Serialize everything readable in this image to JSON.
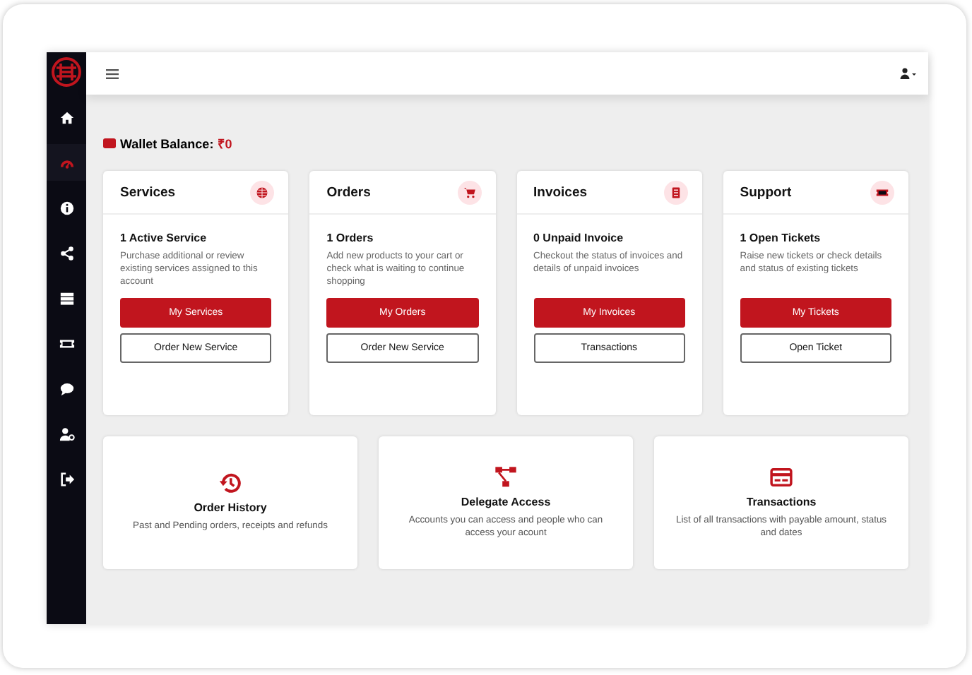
{
  "sidebar": {
    "items": [
      {
        "kind": "home",
        "selected": false
      },
      {
        "kind": "dashboard",
        "selected": true
      },
      {
        "kind": "info",
        "selected": false
      },
      {
        "kind": "share",
        "selected": false
      },
      {
        "kind": "server",
        "selected": false
      },
      {
        "kind": "ticket",
        "selected": false
      },
      {
        "kind": "comment",
        "selected": false
      },
      {
        "kind": "user-settings",
        "selected": false
      },
      {
        "kind": "logout",
        "selected": false
      }
    ]
  },
  "wallet": {
    "label": "Wallet Balance:",
    "amount": "₹0"
  },
  "cards": [
    {
      "title": "Services",
      "kind": "globe",
      "count": "1 Active Service",
      "description": "Purchase additional or review existing services assigned to this account",
      "buttons": [
        "My Services",
        "Order New Service"
      ]
    },
    {
      "title": "Orders",
      "kind": "cart",
      "count": "1 Orders",
      "description": "Add new products to your cart or check what is waiting to continue shopping",
      "buttons": [
        "My Orders",
        "Order New Service"
      ]
    },
    {
      "title": "Invoices",
      "kind": "invoice",
      "count": "0 Unpaid Invoice",
      "description": "Checkout the status of invoices and details of unpaid invoices",
      "buttons": [
        "My Invoices",
        "Transactions"
      ]
    },
    {
      "title": "Support",
      "kind": "ticket",
      "count": "1 Open Tickets",
      "description": "Raise new tickets or check details and status of existing tickets",
      "buttons": [
        "My Tickets",
        "Open Ticket"
      ]
    }
  ],
  "links": [
    {
      "kind": "history",
      "title": "Order History",
      "description": "Past and Pending orders, receipts and refunds"
    },
    {
      "kind": "sitemap",
      "title": "Delegate Access",
      "description": "Accounts you can access and people who can access your acount"
    },
    {
      "kind": "card",
      "title": "Transactions",
      "description": "List of all transactions with payable amount, status and dates"
    }
  ]
}
